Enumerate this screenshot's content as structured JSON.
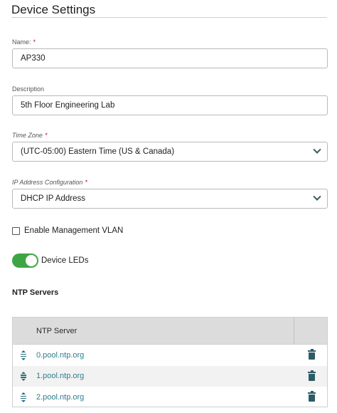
{
  "page": {
    "title": "Device Settings"
  },
  "fields": {
    "name": {
      "label": "Name:",
      "required_mark": "*",
      "value": "AP330"
    },
    "description": {
      "label": "Description",
      "value": "5th Floor Engineering Lab"
    },
    "time_zone": {
      "label": "Time Zone",
      "required_mark": "*",
      "value": "(UTC-05:00) Eastern Time (US & Canada)",
      "icon": "chevron-down-icon"
    },
    "ip_config": {
      "label": "IP Address Configuration",
      "required_mark": "*",
      "value": "DHCP IP Address",
      "icon": "chevron-down-icon"
    }
  },
  "options": {
    "management_vlan": {
      "label": "Enable Management VLAN",
      "checked": false
    },
    "device_leds": {
      "label": "Device LEDs",
      "on": true
    }
  },
  "ntp": {
    "section_title": "NTP Servers",
    "column_header": "NTP Server",
    "rows": [
      "0.pool.ntp.org",
      "1.pool.ntp.org",
      "2.pool.ntp.org"
    ],
    "row_icons": {
      "drag": "drag-handle-icon",
      "delete": "trash-icon"
    }
  },
  "colors": {
    "toggle_on": "#3fa544",
    "link": "#2e7d8c",
    "required": "#d0021b"
  }
}
